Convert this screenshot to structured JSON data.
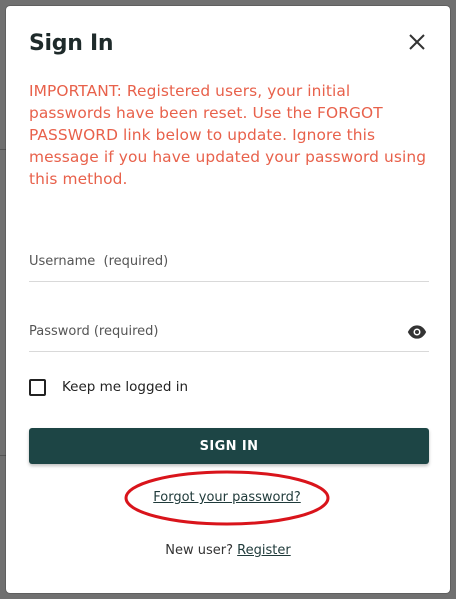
{
  "modal": {
    "title": "Sign In",
    "close_icon": "close-icon",
    "notice": "IMPORTANT: Registered users, your initial passwords have been reset. Use the FORGOT PASSWORD link below to update. Ignore this message if you have updated your password using this method.",
    "notice_color": "#e8614b"
  },
  "form": {
    "username": {
      "placeholder": "Username  (required)",
      "value": ""
    },
    "password": {
      "placeholder": "Password (required)",
      "value": "",
      "toggle_icon": "eye-icon"
    },
    "keep_logged_in": {
      "label": "Keep me logged in",
      "checked": false
    },
    "submit_label": "SIGN IN",
    "submit_color": "#1d4545"
  },
  "links": {
    "forgot_password": "Forgot your password?",
    "new_user_text": "New user?",
    "register": "Register"
  }
}
